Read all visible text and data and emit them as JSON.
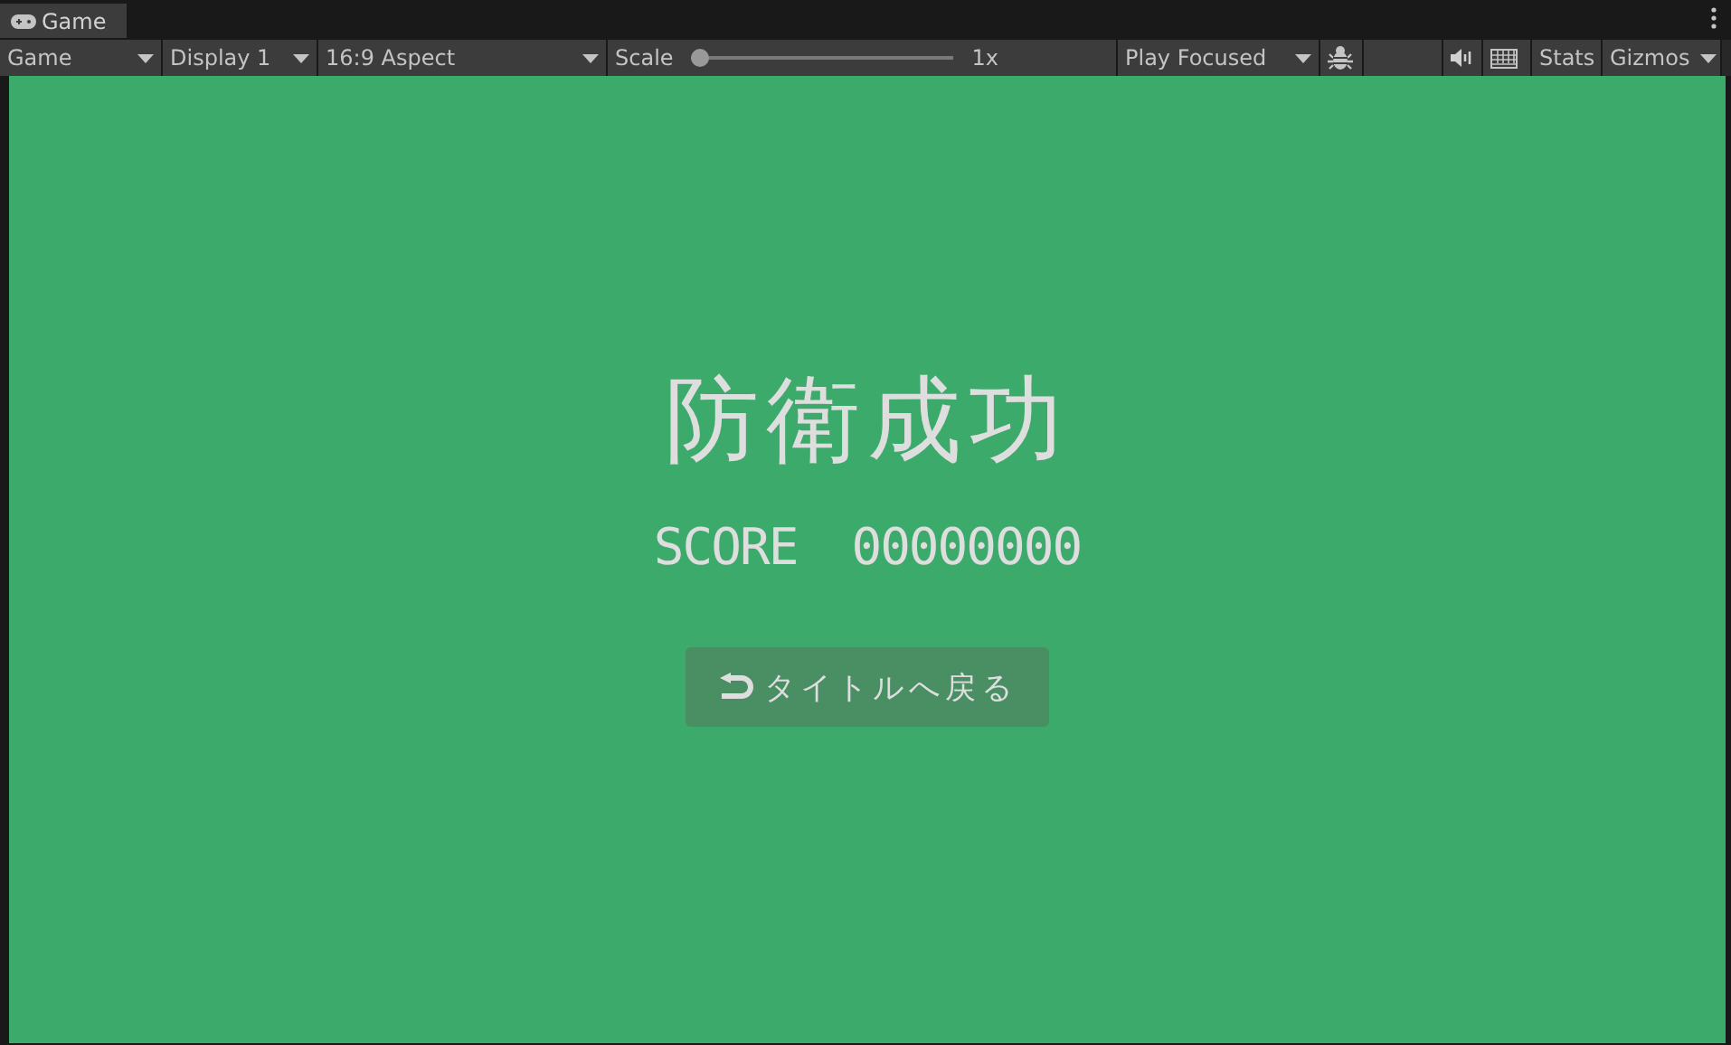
{
  "tab": {
    "title": "Game",
    "selected": true
  },
  "toolbar": [
    {
      "kind": "dropdown",
      "label": "Game"
    },
    {
      "kind": "dropdown",
      "label": "Display 1"
    },
    {
      "kind": "dropdown",
      "label": "16:9 Aspect"
    },
    {
      "kind": "slider",
      "label": "Scale",
      "reading": "1x",
      "level": 0
    },
    {
      "kind": "dropdown",
      "label": "Play Focused"
    },
    {
      "kind": "bug"
    },
    {
      "kind": "blank"
    },
    {
      "kind": "speaker"
    },
    {
      "kind": "keyboard"
    },
    {
      "kind": "button",
      "label": "Stats"
    },
    {
      "kind": "split",
      "label": "Gizmos"
    }
  ],
  "game": {
    "title": "防衛成功",
    "score_label": "SCORE",
    "score_value": "00000000",
    "button": "タイトルへ戻る"
  }
}
